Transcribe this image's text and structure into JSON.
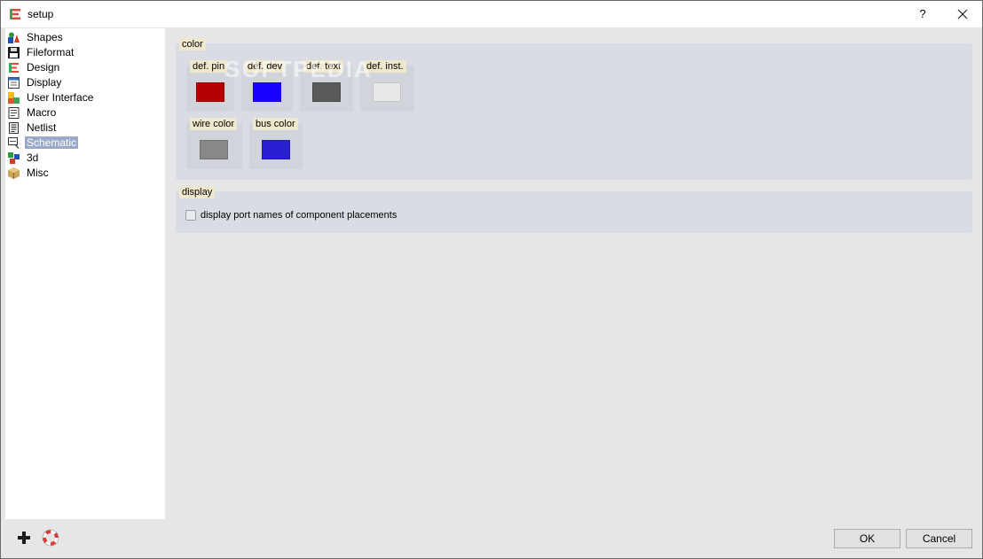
{
  "window": {
    "title": "setup",
    "help_label": "?"
  },
  "sidebar": {
    "items": [
      {
        "label": "Shapes",
        "icon": "shapes-icon"
      },
      {
        "label": "Fileformat",
        "icon": "floppy-disk-icon"
      },
      {
        "label": "Design",
        "icon": "design-icon"
      },
      {
        "label": "Display",
        "icon": "display-window-icon"
      },
      {
        "label": "User Interface",
        "icon": "puzzle-icon"
      },
      {
        "label": "Macro",
        "icon": "macro-script-icon"
      },
      {
        "label": "Netlist",
        "icon": "netlist-document-icon"
      },
      {
        "label": "Schematic",
        "icon": "schematic-icon",
        "selected": true
      },
      {
        "label": "3d",
        "icon": "3d-cubes-icon"
      },
      {
        "label": "Misc",
        "icon": "box-icon"
      }
    ]
  },
  "content": {
    "color_group": {
      "title": "color",
      "swatches": [
        {
          "label": "def. pin",
          "color": "#b40000"
        },
        {
          "label": "def. dev",
          "color": "#1a00ff"
        },
        {
          "label": "def. text",
          "color": "#5a5a5a"
        },
        {
          "label": "def. inst.",
          "color": "#e8e8e8"
        },
        {
          "label": "wire color",
          "color": "#888888"
        },
        {
          "label": "bus color",
          "color": "#2a1fd0"
        }
      ]
    },
    "display_group": {
      "title": "display",
      "checkbox_label": "display port names of component placements",
      "checked": false
    }
  },
  "buttons": {
    "ok": "OK",
    "cancel": "Cancel"
  },
  "watermark": "SOFTPEDIA"
}
